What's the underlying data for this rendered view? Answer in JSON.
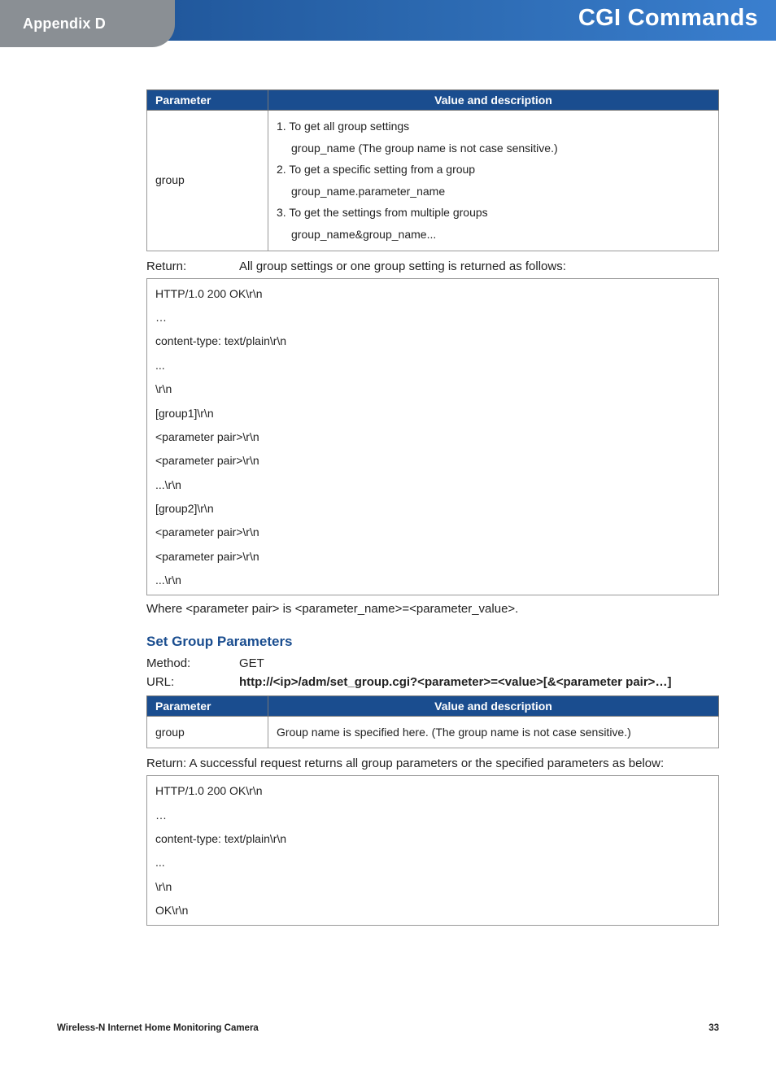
{
  "header": {
    "appendix": "Appendix D",
    "title": "CGI Commands"
  },
  "table1": {
    "col1": "Parameter",
    "col2": "Value and description",
    "row_param": "group",
    "v1": "1. To get all group settings",
    "v1a": "group_name (The group name is not case sensitive.)",
    "v2": "2. To get a specific setting from a group",
    "v2a": "group_name.parameter_name",
    "v3": "3. To get the settings from multiple groups",
    "v3a": "group_name&group_name..."
  },
  "return1": {
    "label": "Return:",
    "text": "All group settings or one group setting is returned as follows:"
  },
  "code1": {
    "l1": "HTTP/1.0 200 OK\\r\\n",
    "l2": "…",
    "l3": "content-type: text/plain\\r\\n",
    "l4": "...",
    "l5": "\\r\\n",
    "l6": "[group1]\\r\\n",
    "l7": "<parameter pair>\\r\\n",
    "l8": "<parameter pair>\\r\\n",
    "l9": "...\\r\\n",
    "l10": "[group2]\\r\\n",
    "l11": "<parameter pair>\\r\\n",
    "l12": "<parameter pair>\\r\\n",
    "l13": "...\\r\\n"
  },
  "note1": "Where <parameter pair> is <parameter_name>=<parameter_value>.",
  "section2": "Set Group Parameters",
  "method": {
    "label": "Method:",
    "value": "GET"
  },
  "url": {
    "label": "URL:",
    "value": "http://<ip>/adm/set_group.cgi?<parameter>=<value>[&<parameter pair>…]"
  },
  "table2": {
    "col1": "Parameter",
    "col2": "Value and description",
    "row_param": "group",
    "row_val": "Group name is specified here. (The group name is not case sensitive.)"
  },
  "return2": "Return: A successful request returns all group parameters or the specified parameters as below:",
  "code2": {
    "l1": "HTTP/1.0 200 OK\\r\\n",
    "l2": "…",
    "l3": "content-type: text/plain\\r\\n",
    "l4": "...",
    "l5": "\\r\\n",
    "l6": "OK\\r\\n"
  },
  "footer": {
    "product": "Wireless-N Internet Home Monitoring Camera",
    "page": "33"
  }
}
